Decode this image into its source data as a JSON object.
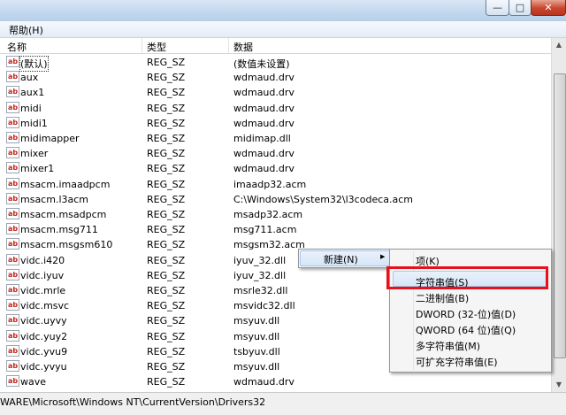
{
  "window": {
    "buttons": {
      "minimize": "—",
      "maximize": "□",
      "close": "✕"
    }
  },
  "menubar": {
    "help": "帮助(H)"
  },
  "columns": {
    "name": "名称",
    "type": "类型",
    "data": "数据"
  },
  "rows": [
    {
      "name": "(默认)",
      "type": "REG_SZ",
      "data": "(数值未设置)"
    },
    {
      "name": "aux",
      "type": "REG_SZ",
      "data": "wdmaud.drv"
    },
    {
      "name": "aux1",
      "type": "REG_SZ",
      "data": "wdmaud.drv"
    },
    {
      "name": "midi",
      "type": "REG_SZ",
      "data": "wdmaud.drv"
    },
    {
      "name": "midi1",
      "type": "REG_SZ",
      "data": "wdmaud.drv"
    },
    {
      "name": "midimapper",
      "type": "REG_SZ",
      "data": "midimap.dll"
    },
    {
      "name": "mixer",
      "type": "REG_SZ",
      "data": "wdmaud.drv"
    },
    {
      "name": "mixer1",
      "type": "REG_SZ",
      "data": "wdmaud.drv"
    },
    {
      "name": "msacm.imaadpcm",
      "type": "REG_SZ",
      "data": "imaadp32.acm"
    },
    {
      "name": "msacm.l3acm",
      "type": "REG_SZ",
      "data": "C:\\Windows\\System32\\l3codeca.acm"
    },
    {
      "name": "msacm.msadpcm",
      "type": "REG_SZ",
      "data": "msadp32.acm"
    },
    {
      "name": "msacm.msg711",
      "type": "REG_SZ",
      "data": "msg711.acm"
    },
    {
      "name": "msacm.msgsm610",
      "type": "REG_SZ",
      "data": "msgsm32.acm"
    },
    {
      "name": "vidc.i420",
      "type": "REG_SZ",
      "data": "iyuv_32.dll"
    },
    {
      "name": "vidc.iyuv",
      "type": "REG_SZ",
      "data": "iyuv_32.dll"
    },
    {
      "name": "vidc.mrle",
      "type": "REG_SZ",
      "data": "msrle32.dll"
    },
    {
      "name": "vidc.msvc",
      "type": "REG_SZ",
      "data": "msvidc32.dll"
    },
    {
      "name": "vidc.uyvy",
      "type": "REG_SZ",
      "data": "msyuv.dll"
    },
    {
      "name": "vidc.yuy2",
      "type": "REG_SZ",
      "data": "msyuv.dll"
    },
    {
      "name": "vidc.yvu9",
      "type": "REG_SZ",
      "data": "tsbyuv.dll"
    },
    {
      "name": "vidc.yvyu",
      "type": "REG_SZ",
      "data": "msyuv.dll"
    },
    {
      "name": "wave",
      "type": "REG_SZ",
      "data": "wdmaud.drv"
    }
  ],
  "row_icon": "ab",
  "status": {
    "path": "WARE\\Microsoft\\Windows NT\\CurrentVersion\\Drivers32"
  },
  "context_menu": {
    "new_label": "新建(N)",
    "arrow": "▶"
  },
  "submenu": {
    "items": [
      {
        "label": "项(K)"
      },
      {
        "label": "字符串值(S)"
      },
      {
        "label": "二进制值(B)"
      },
      {
        "label": "DWORD (32-位)值(D)"
      },
      {
        "label": "QWORD (64 位)值(Q)"
      },
      {
        "label": "多字符串值(M)"
      },
      {
        "label": "可扩充字符串值(E)"
      }
    ],
    "highlighted": "字符串值(S)"
  },
  "colors": {
    "highlight_box": "#e8101a",
    "icon_text": "#c2271c"
  }
}
